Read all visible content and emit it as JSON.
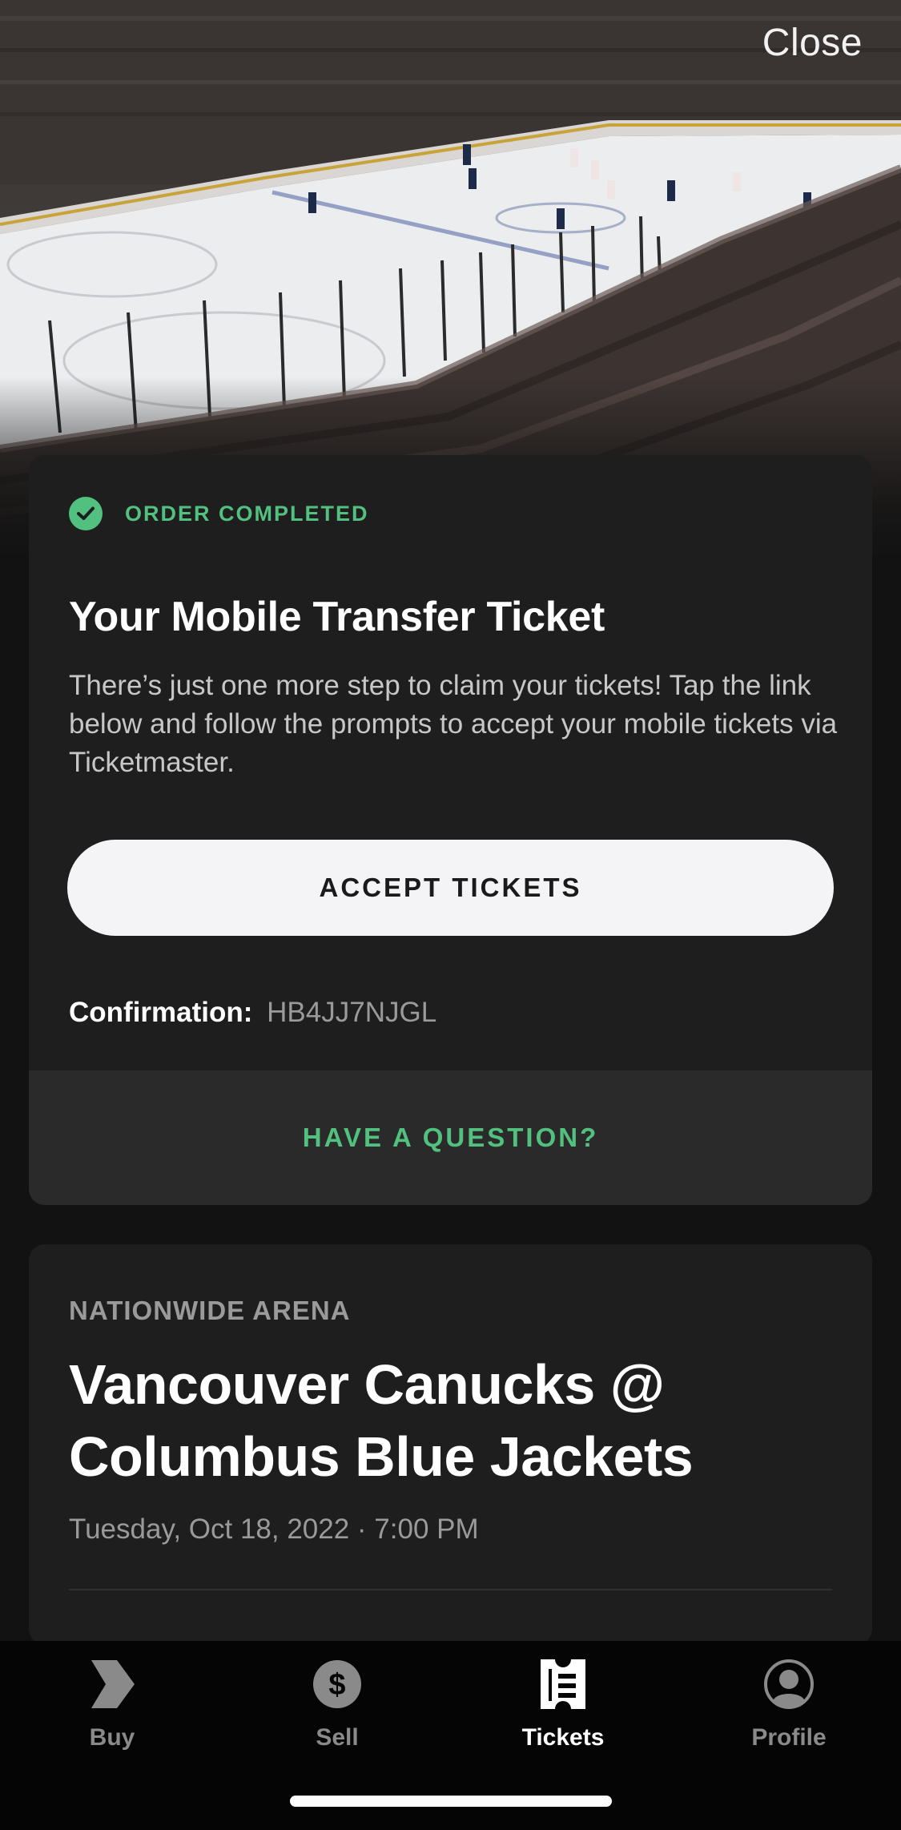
{
  "header": {
    "close_label": "Close"
  },
  "order": {
    "status": "ORDER COMPLETED",
    "title": "Your Mobile Transfer Ticket",
    "description": "There’s just one more step to claim your tickets! Tap the link below and follow the prompts to accept your mobile tickets via Ticketmaster.",
    "accept_label": "ACCEPT TICKETS",
    "confirmation_label": "Confirmation:",
    "confirmation_code": "HB4JJ7NJGL",
    "question_label": "HAVE A QUESTION?"
  },
  "event": {
    "venue": "NATIONWIDE ARENA",
    "title": "Vancouver Canucks @ Columbus Blue Jackets",
    "date": "Tuesday, Oct 18, 2022 · 7:00 PM"
  },
  "tabs": [
    {
      "label": "Buy",
      "icon": "buy-logo-icon",
      "active": false
    },
    {
      "label": "Sell",
      "icon": "dollar-icon",
      "active": false
    },
    {
      "label": "Tickets",
      "icon": "ticket-icon",
      "active": true
    },
    {
      "label": "Profile",
      "icon": "profile-icon",
      "active": false
    }
  ],
  "colors": {
    "accent_green": "#52c17f",
    "card_bg": "#1e1e1e",
    "tabbar_bg": "#050505"
  }
}
